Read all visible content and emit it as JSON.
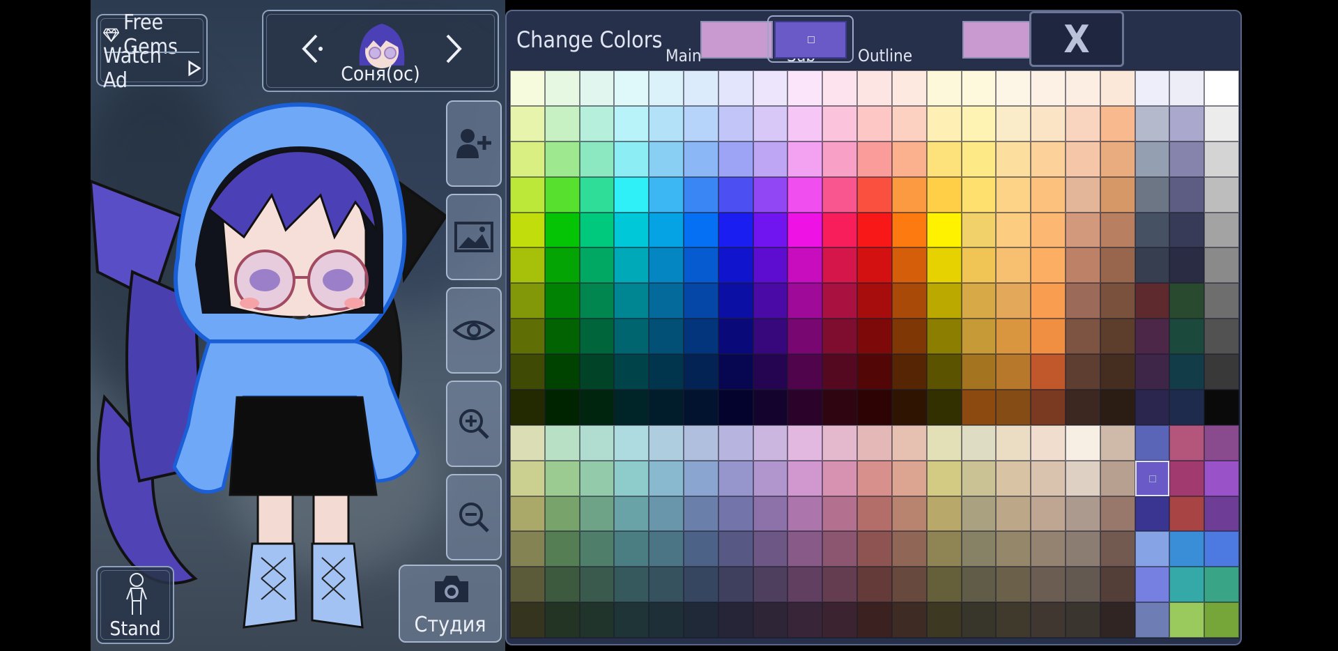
{
  "top_left": {
    "free_gems_label": "Free Gems",
    "watch_ad_label": "Watch Ad",
    "gem_icon": "gem-icon",
    "play_icon": "play-icon"
  },
  "character_selector": {
    "name": "Соня(ос)",
    "prev_icon": "chevron-left-icon",
    "next_icon": "chevron-right-icon"
  },
  "side_buttons": [
    {
      "name": "add-character-button",
      "icon": "add-person-icon"
    },
    {
      "name": "background-button",
      "icon": "image-icon"
    },
    {
      "name": "visibility-button",
      "icon": "eye-icon"
    },
    {
      "name": "zoom-in-button",
      "icon": "zoom-in-icon"
    },
    {
      "name": "zoom-out-button",
      "icon": "zoom-out-icon"
    }
  ],
  "stand_button": {
    "label": "Stand",
    "icon": "pose-figure-icon"
  },
  "studio_button": {
    "label": "Студия",
    "icon": "camera-icon"
  },
  "color_panel": {
    "title": "Change Colors",
    "main_label": "Main",
    "sub_label": "Sub",
    "outline_label": "Outline",
    "main_color": "#c99ad0",
    "sub_color": "#6a5ac8",
    "outline_color": "#c99ad0",
    "close_label": "X",
    "selected_cell": {
      "row": 11,
      "col": 18
    }
  },
  "palette": [
    [
      "#f6fbde",
      "#e6f8e2",
      "#e0f6ef",
      "#dff9fb",
      "#dcf2fb",
      "#dcebfc",
      "#e2e5fb",
      "#ece5fb",
      "#fbe5fb",
      "#fde3ee",
      "#fde5e3",
      "#fde9df",
      "#fef8da",
      "#fef9dc",
      "#fdf6e6",
      "#fdf1e5",
      "#fdeee3",
      "#fce8d9",
      "#eeeefa",
      "#ededf8",
      "#ffffff"
    ],
    [
      "#e7f4ab",
      "#c8f1c3",
      "#b6efdc",
      "#b7f3f8",
      "#b3e1f8",
      "#b6d3fa",
      "#c1c5f8",
      "#d7c8f8",
      "#f5c6f6",
      "#fcc3dc",
      "#fcc7c5",
      "#fcd1c1",
      "#fef0b5",
      "#fff3b3",
      "#fbecc9",
      "#fbe3c6",
      "#f9d4be",
      "#f8b98f",
      "#b4b9cc",
      "#aba8ce",
      "#ececec"
    ],
    [
      "#d9ef82",
      "#9ee890",
      "#8be8c0",
      "#8ceef4",
      "#88cff3",
      "#8bb7f6",
      "#9da4f5",
      "#bea6f5",
      "#f3a2f1",
      "#f9a0c6",
      "#fa9d9a",
      "#fbb08e",
      "#fde17a",
      "#fee987",
      "#fcdf9e",
      "#fcd29a",
      "#f5c6a8",
      "#e9ac7e",
      "#94a0b2",
      "#8684ad",
      "#d4d4d4"
    ],
    [
      "#bce83a",
      "#58e02e",
      "#2fdc98",
      "#2ef0f6",
      "#3db7f4",
      "#3a86f5",
      "#4c4ff2",
      "#9147f3",
      "#f14ef0",
      "#f9558e",
      "#f95040",
      "#fb9a40",
      "#fecf47",
      "#fde06e",
      "#fcd387",
      "#fdc17e",
      "#e3b69a",
      "#d69866",
      "#6c7685",
      "#5d5c83",
      "#bdbdbd"
    ],
    [
      "#c1dd0c",
      "#05c405",
      "#00c87c",
      "#00c8d8",
      "#05a2e4",
      "#0670f5",
      "#1b1ef0",
      "#7015ef",
      "#ee13e4",
      "#f81e5c",
      "#f81818",
      "#fd7a11",
      "#fff200",
      "#f0d16a",
      "#fccd80",
      "#fcb773",
      "#d2997d",
      "#b88060",
      "#475164",
      "#383b57",
      "#a3a3a3"
    ],
    [
      "#a7c00a",
      "#03a403",
      "#00a863",
      "#00a9b8",
      "#0486c2",
      "#055bcf",
      "#1114cd",
      "#5d0dd0",
      "#c80dbf",
      "#d4164a",
      "#d41111",
      "#d55e0a",
      "#e5d200",
      "#f0c556",
      "#f7c070",
      "#fcae62",
      "#bd8168",
      "#98664c",
      "#363e50",
      "#292c42",
      "#8a8a8a"
    ],
    [
      "#829808",
      "#028202",
      "#00864e",
      "#008693",
      "#036a9b",
      "#0447a6",
      "#0c0fa3",
      "#4a0aa6",
      "#a00a98",
      "#a91140",
      "#a80d0d",
      "#aa4a08",
      "#bca900",
      "#d7a947",
      "#e4a85a",
      "#f99e50",
      "#9b6a58",
      "#7a513d",
      "#5e2a2e",
      "#294a2f",
      "#6e6e6e"
    ],
    [
      "#5f6f06",
      "#016301",
      "#00653b",
      "#00656f",
      "#025075",
      "#03357c",
      "#09097a",
      "#37077c",
      "#780772",
      "#7f0d30",
      "#7d0909",
      "#7f3706",
      "#8b7e00",
      "#c59a37",
      "#d9963f",
      "#f08f42",
      "#7d5341",
      "#5d3d2c",
      "#4c2748",
      "#1b4a3d",
      "#525252"
    ],
    [
      "#3f4a04",
      "#004200",
      "#004327",
      "#00444a",
      "#01354e",
      "#022353",
      "#060651",
      "#250552",
      "#4f044b",
      "#550920",
      "#530606",
      "#552504",
      "#5b5300",
      "#a57421",
      "#b8782c",
      "#c1582c",
      "#5e3e30",
      "#452d20",
      "#3d2648",
      "#123c48",
      "#393939"
    ],
    [
      "#232a02",
      "#002400",
      "#00250e",
      "#002529",
      "#011d2b",
      "#01132e",
      "#03032d",
      "#14032d",
      "#2b022a",
      "#2f0512",
      "#2e0303",
      "#2f1402",
      "#323000",
      "#8c4a11",
      "#864c16",
      "#7a3a22",
      "#3c2820",
      "#2b1c14",
      "#2a264d",
      "#1f2b4c",
      "#0a0a0a"
    ],
    [
      "#dbddb4",
      "#b8e0c4",
      "#b0ddd0",
      "#addbe0",
      "#aecdde",
      "#b1bfdf",
      "#b7b5df",
      "#cab6df",
      "#e2b8e0",
      "#e4b9cd",
      "#e4b8b6",
      "#e6c1b2",
      "#e3e0b8",
      "#dfdcc4",
      "#ebdcc4",
      "#f0ddcd",
      "#f8efe4",
      "#cfb9a8",
      "#5a65b8",
      "#b4567c",
      "#8a4a8e"
    ],
    [
      "#cbd090",
      "#9ccb92",
      "#92caaa",
      "#8ecbcb",
      "#88b9ce",
      "#8aa5cf",
      "#9696cc",
      "#b096cd",
      "#d098cf",
      "#d792b1",
      "#d8908c",
      "#dca592",
      "#d3ca84",
      "#cac295",
      "#d8c4a4",
      "#d9c2ae",
      "#dfd0c4",
      "#b8a090",
      "#6a5ac8",
      "#a13a6e",
      "#9a52c8"
    ],
    [
      "#aaa96a",
      "#78a46c",
      "#6ea388",
      "#6aa3a7",
      "#6996aa",
      "#6a80ab",
      "#7374a9",
      "#8d72aa",
      "#ac75ac",
      "#b3708f",
      "#b46e6a",
      "#b88470",
      "#b8a96a",
      "#a9a180",
      "#bca888",
      "#bfa693",
      "#ab9a8d",
      "#97786a",
      "#3a3590",
      "#a84444",
      "#6e3e96"
    ],
    [
      "#838353",
      "#567e55",
      "#4f7e6a",
      "#4b7e82",
      "#4b7485",
      "#4c6286",
      "#575984",
      "#6d5885",
      "#875a87",
      "#8c5670",
      "#8d5452",
      "#906656",
      "#8f8453",
      "#878165",
      "#958769",
      "#958371",
      "#8c7d72",
      "#735a50",
      "#86a3e6",
      "#3a8ed8",
      "#4d7ae0"
    ],
    [
      "#5b5b3a",
      "#3d5a3e",
      "#395a4c",
      "#36595d",
      "#36525f",
      "#364660",
      "#3f3f5e",
      "#4e3f5f",
      "#613f61",
      "#653d50",
      "#653b3a",
      "#67493d",
      "#66603a",
      "#615c48",
      "#6b614b",
      "#6b5d51",
      "#645951",
      "#533f38",
      "#7580e0",
      "#35a8a8",
      "#3aa586"
    ],
    [
      "#35351f",
      "#243424",
      "#21342b",
      "#1f3436",
      "#1f2f37",
      "#1f2938",
      "#252537",
      "#2e2537",
      "#382538",
      "#3b242f",
      "#3b2221",
      "#3d2b24",
      "#3c3822",
      "#38362a",
      "#3f3a2c",
      "#3f3730",
      "#3b352f",
      "#302522",
      "#6e7db4",
      "#9ac95e",
      "#76a63a"
    ]
  ]
}
